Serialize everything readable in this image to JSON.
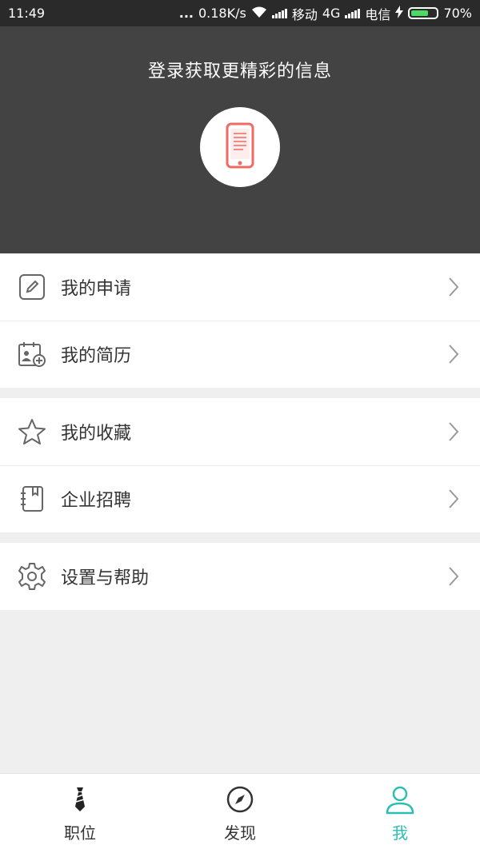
{
  "status_bar": {
    "time": "11:49",
    "dots": "...",
    "speed": "0.18K/s",
    "carrier1": "移动",
    "network": "4G",
    "carrier2": "电信",
    "battery": "70%",
    "battery_level": 0.7
  },
  "header": {
    "title": "登录获取更精彩的信息",
    "avatar_icon": "phone-icon"
  },
  "menu": {
    "group1": [
      {
        "label": "我的申请",
        "icon": "edit-icon"
      },
      {
        "label": "我的简历",
        "icon": "resume-icon"
      }
    ],
    "group2": [
      {
        "label": "我的收藏",
        "icon": "star-icon"
      },
      {
        "label": "企业招聘",
        "icon": "recruit-icon"
      }
    ],
    "group3": [
      {
        "label": "设置与帮助",
        "icon": "gear-icon"
      }
    ]
  },
  "tabs": [
    {
      "label": "职位",
      "icon": "tie-icon",
      "active": false
    },
    {
      "label": "发现",
      "icon": "compass-icon",
      "active": false
    },
    {
      "label": "我",
      "icon": "user-icon",
      "active": true
    }
  ],
  "colors": {
    "accent": "#2bbfb3",
    "header_bg": "#434343",
    "phone_icon": "#ef6a63"
  }
}
